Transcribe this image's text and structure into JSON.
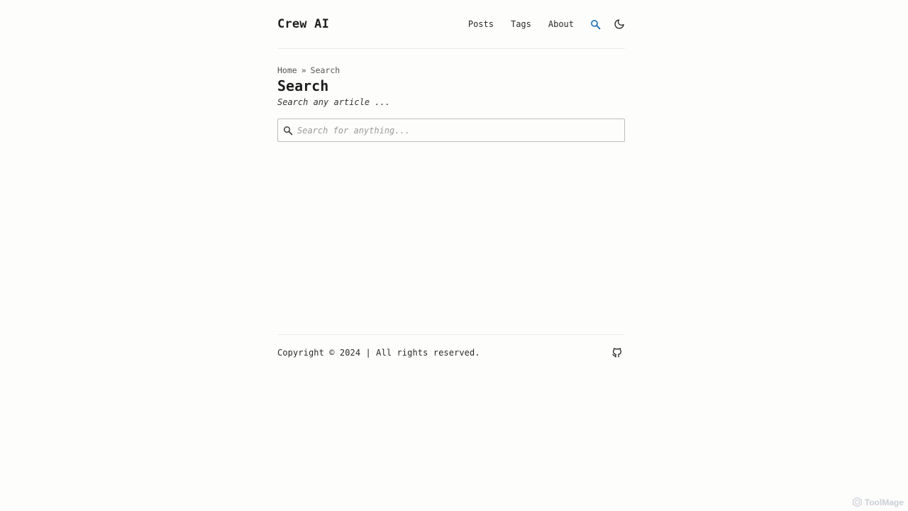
{
  "site": {
    "title": "Crew AI"
  },
  "nav": {
    "items": [
      {
        "label": "Posts"
      },
      {
        "label": "Tags"
      },
      {
        "label": "About"
      }
    ],
    "search_icon": "search-icon",
    "theme_icon": "moon-icon",
    "accent_color": "#1f6fb2"
  },
  "breadcrumb": {
    "home": "Home",
    "separator": "»",
    "current": "Search"
  },
  "page": {
    "title": "Search",
    "description": "Search any article ..."
  },
  "search": {
    "placeholder": "Search for anything...",
    "value": "",
    "icon": "search-icon"
  },
  "footer": {
    "copyright": "Copyright © 2024 | All rights reserved.",
    "icon": "github-icon"
  },
  "watermark": {
    "label": "ToolMage"
  }
}
